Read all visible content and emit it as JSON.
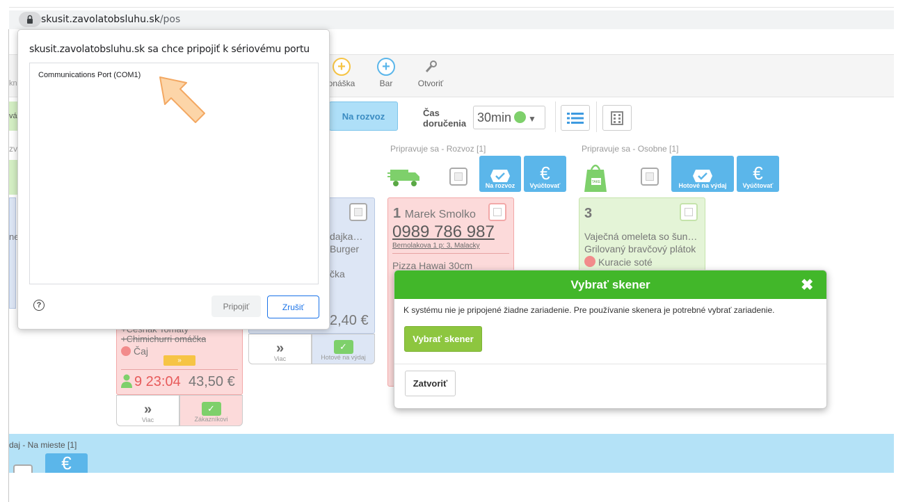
{
  "browser": {
    "domain": "skusit.zavolatobsluhu.sk",
    "path": "/pos"
  },
  "toolbar": {
    "items": [
      {
        "label": "Donáška",
        "visible": "onáška",
        "color": "#f6c445"
      },
      {
        "label": "Bar",
        "color": "#5bb6ea"
      },
      {
        "label": "Otvoriť",
        "color": "#999999"
      }
    ],
    "left_fragment": "kn"
  },
  "filters": {
    "na_rozvoz": "Na rozvoz",
    "cas_line1": "Čas",
    "cas_line2": "doručenia",
    "time_value": "30min",
    "status_color": "#7ed06b",
    "left_frag_1": "vá",
    "left_frag_2": "zv"
  },
  "sections": {
    "rozvoz": {
      "label": "Pripravuje sa - Rozvoz [1]",
      "btn_primary": "Na rozvoz",
      "btn_bill": "Vyúčtovať"
    },
    "osobne": {
      "label": "Pripravuje sa - Osobne [1]",
      "btn_primary": "Hotové na výdaj",
      "btn_bill": "Vyúčtovať"
    },
    "bottom": {
      "label": "daj - Na mieste [1]"
    }
  },
  "cards": {
    "marek": {
      "number": "1",
      "name": "Marek Smolko",
      "phone": "0989 786 987",
      "address": "Bernolakova 1 p: 3, Malacky",
      "item": "Pizza Hawai 30cm"
    },
    "three": {
      "number": "3",
      "items": [
        "Vaječná omeleta so šun…",
        "Grilovaný bravčový plátok"
      ],
      "item_dot": "Kuracie soté"
    },
    "blue": {
      "items": [
        "dajka…",
        "Burger",
        "čka"
      ],
      "price": "2,40 €",
      "btn_more": "Viac",
      "btn_ready": "Hotové na výdaj"
    },
    "red": {
      "item_strike1": "+Cesnak Tomaty",
      "item_strike2": "+Chimichurri omáčka",
      "item_dot": "Čaj",
      "time": "9 23:04",
      "price": "43,50 €",
      "btn_more": "Viac",
      "btn_customer": "Zákazníkovi"
    },
    "left_frag": "ne"
  },
  "permission_dialog": {
    "title": "skusit.zavolatobsluhu.sk sa chce pripojiť k sériovému portu",
    "port": "Communications Port (COM1)",
    "connect": "Pripojiť",
    "cancel": "Zrušiť",
    "help": "?"
  },
  "scanner_modal": {
    "title": "Vybrať skener",
    "message": "K systému nie je pripojené žiadne zariadenie. Pre používanie skenera je potrebné vybrať zariadenie.",
    "select_button": "Vybrať skener",
    "close_button": "Zatvoriť",
    "close_icon": "✖"
  }
}
